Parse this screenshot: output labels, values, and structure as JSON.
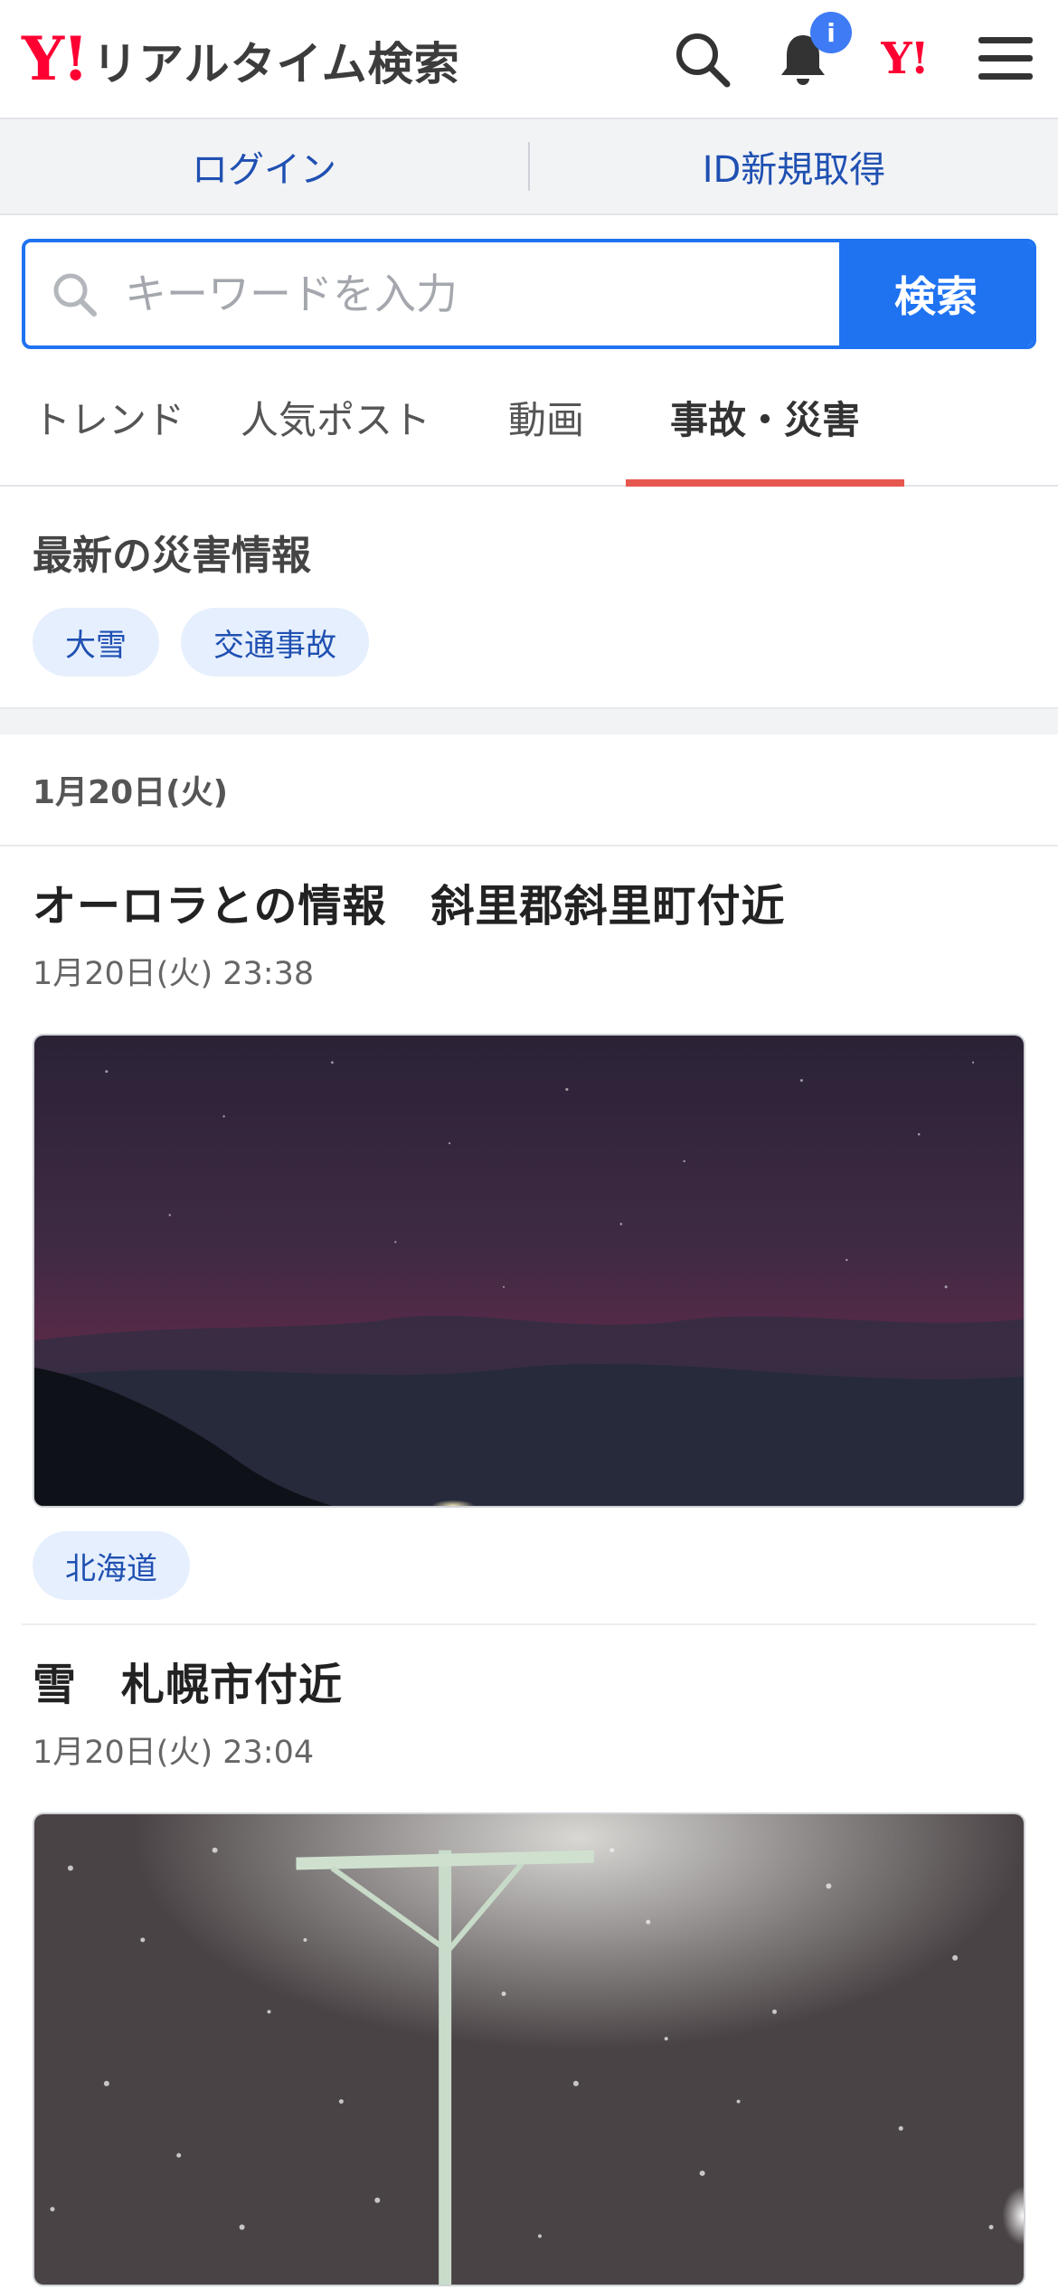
{
  "header": {
    "logo_mark": "Y!",
    "logo_text": "リアルタイム検索",
    "notice_badge": "i",
    "yahoo_mark": "Y!"
  },
  "account": {
    "login_label": "ログイン",
    "register_label": "ID新規取得"
  },
  "search": {
    "placeholder": "キーワードを入力",
    "button_label": "検索"
  },
  "tabs": [
    {
      "label": "トレンド",
      "active": false
    },
    {
      "label": "人気ポスト",
      "active": false
    },
    {
      "label": "動画",
      "active": false
    },
    {
      "label": "事故・災害",
      "active": true
    }
  ],
  "disaster": {
    "title": "最新の災害情報",
    "chips": [
      "大雪",
      "交通事故"
    ]
  },
  "date_header": "1月20日(火)",
  "posts": [
    {
      "title": "オーロラとの情報　斜里郡斜里町付近",
      "time": "1月20日(火) 23:38",
      "image_icon": "aurora-night-sky-photo",
      "tags": [
        "北海道"
      ]
    },
    {
      "title": "雪　札幌市付近",
      "time": "1月20日(火) 23:04",
      "image_icon": "snowfall-streetlight-photo",
      "tags": []
    }
  ],
  "colors": {
    "brand_red": "#ff0033",
    "accent_blue": "#1f73f1",
    "tab_indicator": "#e6574f",
    "link_blue": "#1f50b2"
  }
}
